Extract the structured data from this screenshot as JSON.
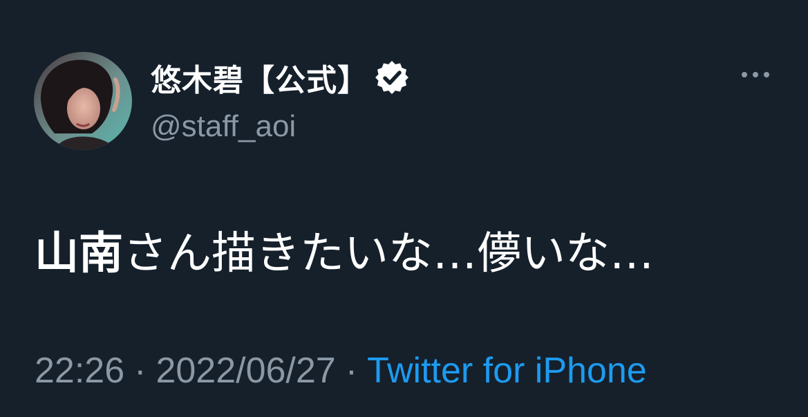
{
  "tweet": {
    "author": {
      "display_name": "悠木碧【公式】",
      "handle": "@staff_aoi",
      "verified": true
    },
    "text_bold": "山南",
    "text_rest": "さん描きたいな…儚いな…",
    "time": "22:26",
    "separator": "·",
    "date": "2022/06/27",
    "source": "Twitter for iPhone"
  },
  "icons": {
    "verified": "verified-badge-icon",
    "more": "more-options-icon"
  },
  "colors": {
    "background": "#15202b",
    "text_primary": "#ffffff",
    "text_secondary": "#8b98a5",
    "link": "#1d9bf0"
  }
}
